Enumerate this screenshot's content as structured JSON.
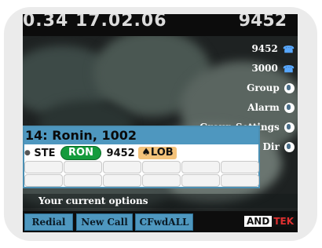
{
  "status_bar": {
    "clock": "0.34 17.02.06",
    "extension": "9452"
  },
  "function_keys": [
    {
      "label": "9452",
      "icon": "phone-icon"
    },
    {
      "label": "3000",
      "icon": "phone-icon"
    },
    {
      "label": "Group",
      "icon": "globe-icon"
    },
    {
      "label": "Alarm",
      "icon": "globe-icon"
    },
    {
      "label": "Group Settings",
      "icon": "globe-icon"
    },
    {
      "label": "Dir",
      "icon": "globe-icon"
    }
  ],
  "dialog": {
    "title": "14: Ronin, 1002",
    "status": {
      "prefix": "STE",
      "user_code": "RON",
      "extension": "9452",
      "state": "LOB",
      "state_icon": "bell-icon"
    }
  },
  "options_label": "Your current options",
  "softkeys": [
    "Redial",
    "New Call",
    "CFwdALL"
  ],
  "brand": {
    "part1": "AND",
    "part2": "TEK"
  },
  "colors": {
    "accent_blue": "#4e97bf",
    "status_green": "#149b3c",
    "status_orange": "#f3c27a",
    "brand_red": "#e03030"
  }
}
